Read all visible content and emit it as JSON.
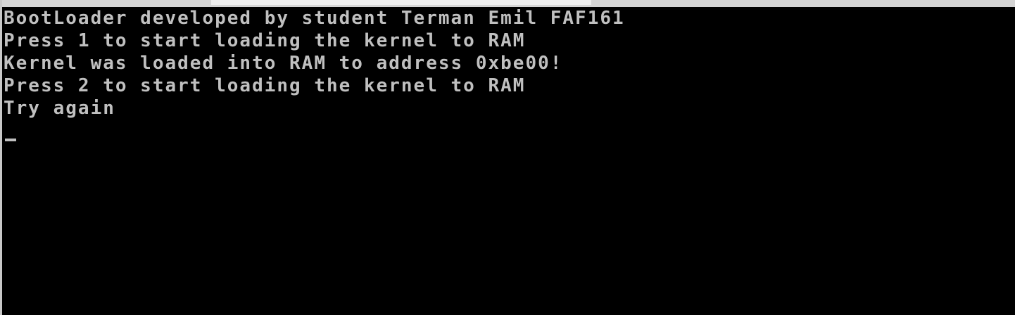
{
  "console": {
    "lines": [
      "BootLoader developed by student Terman Emil FAF161",
      "Press 1 to start loading the kernel to RAM",
      "Kernel was loaded into RAM to address 0xbe00!",
      "Press 2 to start loading the kernel to RAM",
      "Try again"
    ],
    "cursor": "_"
  },
  "colors": {
    "background": "#000000",
    "text": "#c0c0c0"
  }
}
